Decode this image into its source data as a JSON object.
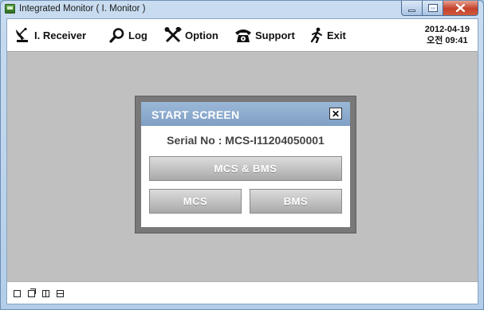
{
  "window": {
    "title": "Integrated Monitor ( I. Monitor )"
  },
  "toolbar": {
    "items": [
      {
        "label": "I. Receiver",
        "icon": "satellite-dish-icon"
      },
      {
        "label": "Log",
        "icon": "magnifier-icon"
      },
      {
        "label": "Option",
        "icon": "tools-icon"
      },
      {
        "label": "Support",
        "icon": "telephone-icon"
      },
      {
        "label": "Exit",
        "icon": "running-man-icon"
      }
    ]
  },
  "clock": {
    "date": "2012-04-19",
    "time": "오전 09:41"
  },
  "dialog": {
    "title": "START SCREEN",
    "close_label": "✕",
    "serial": "Serial No : MCS-I11204050001",
    "buttons": {
      "both": "MCS & BMS",
      "mcs": "MCS",
      "bms": "BMS"
    }
  },
  "colors": {
    "dialog_header": "#8fadd1",
    "workspace": "#c0c0c0",
    "button_gray": "#c4c4c4"
  }
}
